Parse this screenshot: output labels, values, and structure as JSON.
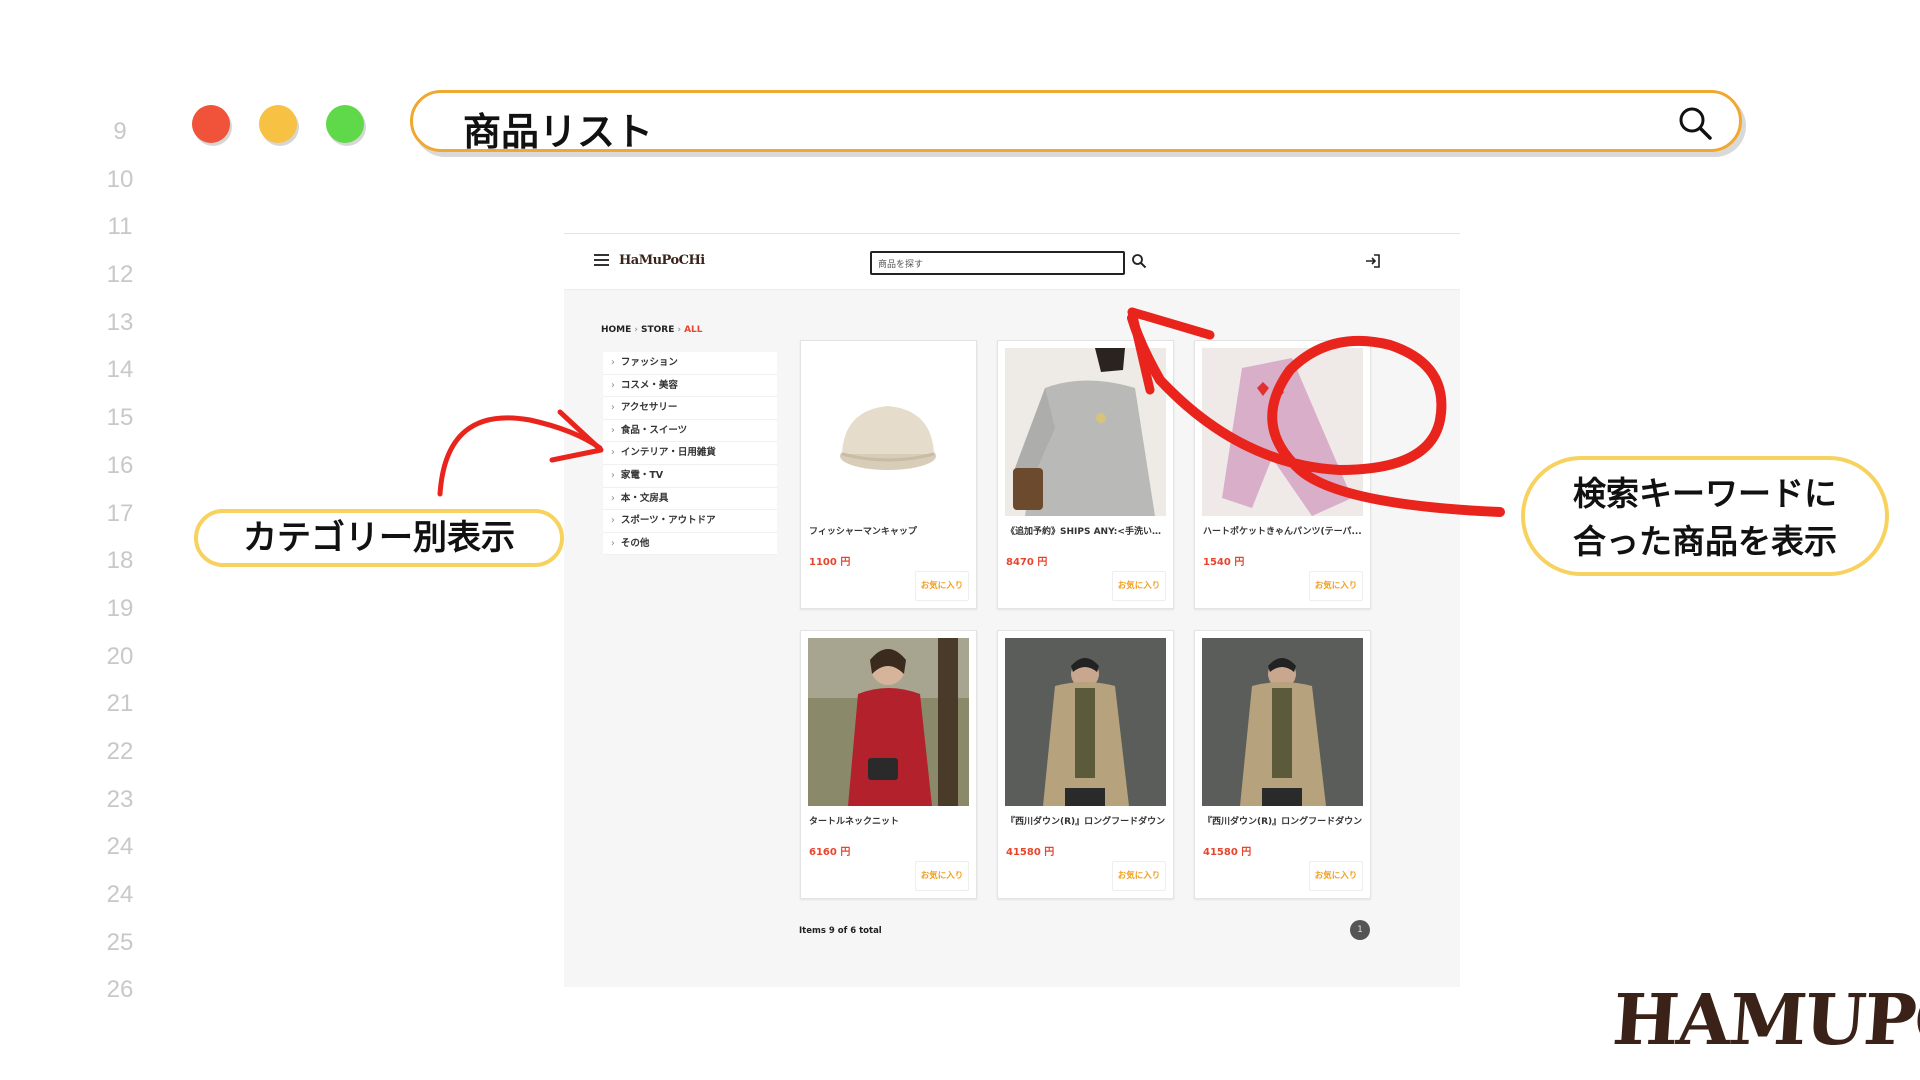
{
  "line_numbers": [
    "9",
    "10",
    "11",
    "12",
    "13",
    "14",
    "15",
    "16",
    "17",
    "18",
    "19",
    "20",
    "21",
    "22",
    "23",
    "24",
    "24",
    "25",
    "26"
  ],
  "titlebar": {
    "text": "商品リスト",
    "search_icon": "search-icon"
  },
  "site": {
    "brand": "HaMuPoCHi",
    "search_placeholder": "商品を探す",
    "breadcrumb": {
      "home": "HOME",
      "store": "STORE",
      "current": "ALL"
    },
    "categories": [
      "ファッション",
      "コスメ・美容",
      "アクセサリー",
      "食品・スイーツ",
      "インテリア・日用雑貨",
      "家電・TV",
      "本・文房具",
      "スポーツ・アウトドア",
      "その他"
    ],
    "products": [
      {
        "name": "フィッシャーマンキャップ",
        "price": "1100 円",
        "fav": "お気に入り"
      },
      {
        "name": "《追加予約》SHIPS ANY:<手洗い可...",
        "price": "8470 円",
        "fav": "お気に入り"
      },
      {
        "name": "ハートポケットきゃんパンツ(テーパ...",
        "price": "1540 円",
        "fav": "お気に入り"
      },
      {
        "name": "タートルネックニット",
        "price": "6160 円",
        "fav": "お気に入り"
      },
      {
        "name": "『西川ダウン(R)』ロングフードダウン",
        "price": "41580 円",
        "fav": "お気に入り"
      },
      {
        "name": "『西川ダウン(R)』ロングフードダウン",
        "price": "41580 円",
        "fav": "お気に入り"
      }
    ],
    "items_total": "Items 9 of 6 total",
    "page": "1"
  },
  "callouts": {
    "category": "カテゴリー別表示",
    "search_line1": "検索キーワードに",
    "search_line2": "合った商品を表示"
  },
  "logo": "HAMUPOCHI",
  "colors": {
    "accent_orange": "#f0a830",
    "callout_yellow": "#f7d25e",
    "arrow_red": "#e8241c",
    "price_red": "#e8452c"
  }
}
